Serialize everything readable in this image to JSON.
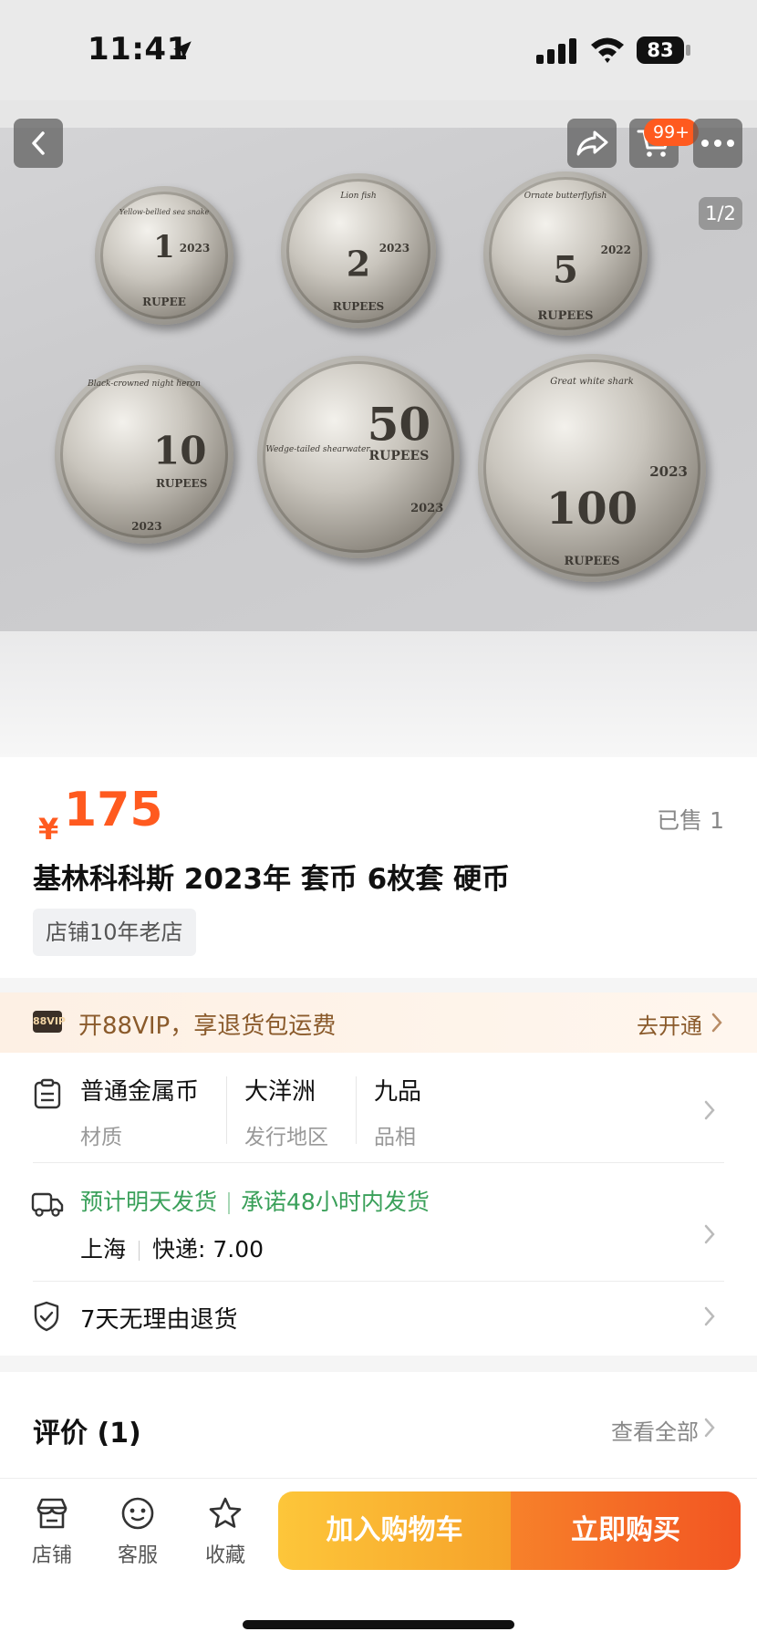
{
  "status_bar": {
    "time": "11:41",
    "battery": "83"
  },
  "gallery": {
    "page_indicator": "1/2",
    "cart_badge": "99+",
    "coins": [
      {
        "value": "1",
        "unit": "RUPEE",
        "year": "2023",
        "animal": "Yellow-bellied sea snake"
      },
      {
        "value": "2",
        "unit": "RUPEES",
        "year": "2023",
        "animal": "Lion fish"
      },
      {
        "value": "5",
        "unit": "RUPEES",
        "year": "2022",
        "animal": "Ornate butterflyfish"
      },
      {
        "value": "10",
        "unit": "RUPEES",
        "year": "2023",
        "animal": "Black-crowned night heron"
      },
      {
        "value": "50",
        "unit": "RUPEES",
        "year": "2023",
        "animal": "Wedge-tailed shearwater"
      },
      {
        "value": "100",
        "unit": "RUPEES",
        "year": "2023",
        "animal": "Great white shark"
      }
    ]
  },
  "product": {
    "currency": "¥",
    "price": "175",
    "sold": "已售 1",
    "title": "基林科科斯 2023年 套币 6枚套 硬币",
    "shop_tag": "店铺10年老店"
  },
  "vip": {
    "logo": "88VIP",
    "text": "开88VIP，享退货包运费",
    "link": "去开通"
  },
  "attributes": [
    {
      "value": "普通金属币",
      "key": "材质"
    },
    {
      "value": "大洋洲",
      "key": "发行地区"
    },
    {
      "value": "九品",
      "key": "品相"
    }
  ],
  "shipping": {
    "eta": "预计明天发货",
    "promise": "承诺48小时内发货",
    "origin": "上海",
    "fee": "快递: 7.00"
  },
  "returns": {
    "text": "7天无理由退货"
  },
  "reviews": {
    "title": "评价 (1)",
    "link": "查看全部"
  },
  "bottom_bar": {
    "tabs": [
      {
        "label": "店铺"
      },
      {
        "label": "客服"
      },
      {
        "label": "收藏"
      }
    ],
    "add_to_cart": "加入购物车",
    "buy_now": "立即购买"
  }
}
